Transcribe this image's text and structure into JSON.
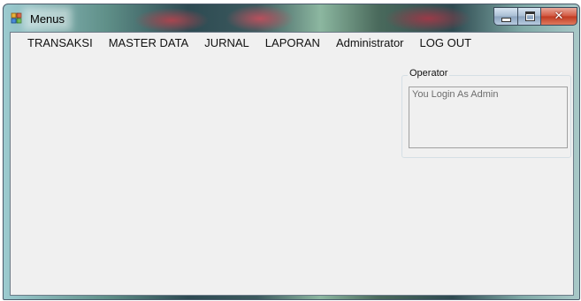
{
  "window": {
    "title": "Menus",
    "controls": {
      "minimize_icon": "minimize-icon",
      "maximize_icon": "maximize-icon",
      "close_icon": "close-icon",
      "close_glyph": "✕"
    }
  },
  "menu": {
    "items": [
      {
        "label": "TRANSAKSI"
      },
      {
        "label": "MASTER DATA"
      },
      {
        "label": "JURNAL"
      },
      {
        "label": "LAPORAN"
      },
      {
        "label": "Administrator"
      },
      {
        "label": "LOG OUT"
      }
    ]
  },
  "operator": {
    "group_label": "Operator",
    "text": "You Login As Admin"
  },
  "colors": {
    "client_bg": "#f0f0f0",
    "close_button": "#c03a20",
    "status_text": "#6d6d6d"
  }
}
